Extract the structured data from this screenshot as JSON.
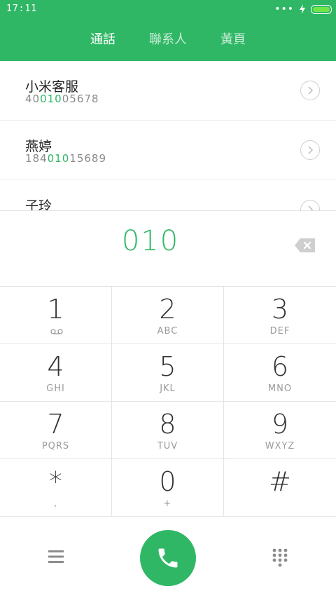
{
  "status_bar": {
    "time": "17:11",
    "signal_dots": "•••"
  },
  "tabs": [
    {
      "label": "通話",
      "active": true
    },
    {
      "label": "聯系人",
      "active": false
    },
    {
      "label": "黃頁",
      "active": false
    }
  ],
  "contacts": [
    {
      "name": "小米客服",
      "number_pre": "40",
      "number_match": "010",
      "number_post": "05678"
    },
    {
      "name": "燕婷",
      "number_pre": "184",
      "number_match": "010",
      "number_post": "15689"
    },
    {
      "name": "子玲",
      "number_pre": "",
      "number_match": "",
      "number_post": ""
    }
  ],
  "dialed_number": "010",
  "keypad": [
    {
      "digit": "1",
      "letters": ""
    },
    {
      "digit": "2",
      "letters": "ABC"
    },
    {
      "digit": "3",
      "letters": "DEF"
    },
    {
      "digit": "4",
      "letters": "GHI"
    },
    {
      "digit": "5",
      "letters": "JKL"
    },
    {
      "digit": "6",
      "letters": "MNO"
    },
    {
      "digit": "7",
      "letters": "PQRS"
    },
    {
      "digit": "8",
      "letters": "TUV"
    },
    {
      "digit": "9",
      "letters": "WXYZ"
    },
    {
      "digit": "*",
      "letters": ","
    },
    {
      "digit": "0",
      "letters": "+"
    },
    {
      "digit": "#",
      "letters": ""
    }
  ],
  "colors": {
    "accent": "#2fb765",
    "battery": "#6ee64a"
  },
  "icons": {
    "backspace": "backspace-icon",
    "menu": "menu-icon",
    "call": "phone-icon",
    "dialpad": "dialpad-icon",
    "voicemail": "voicemail-icon",
    "chevron": "chevron-right-icon"
  }
}
